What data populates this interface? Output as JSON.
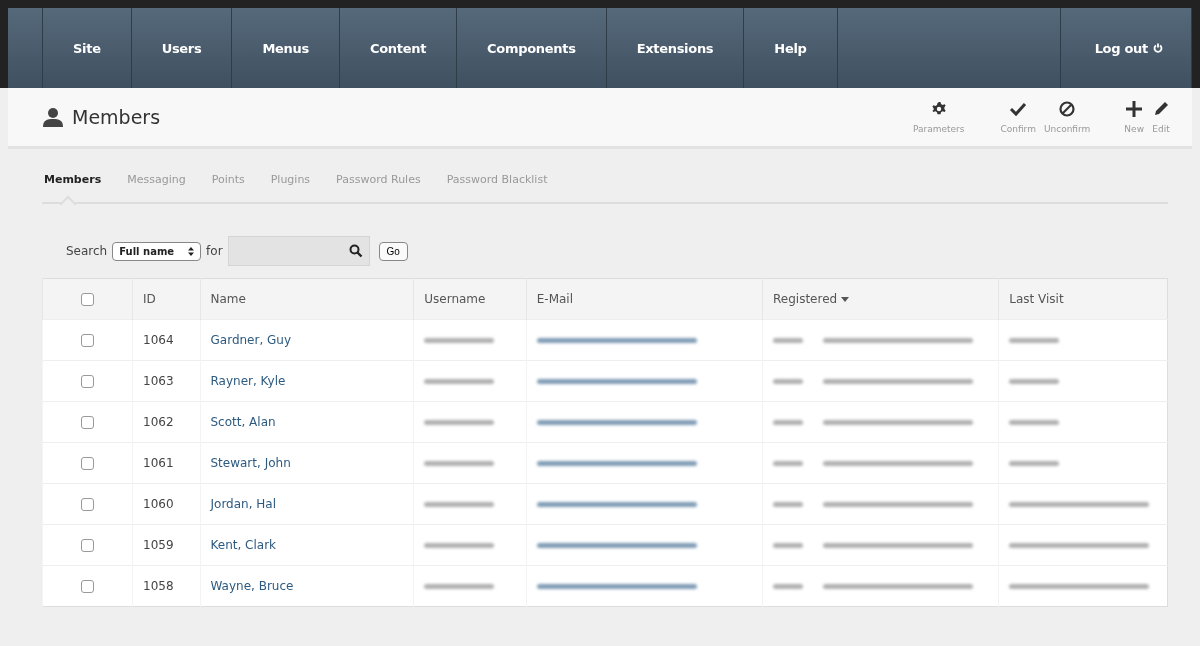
{
  "nav": {
    "items": [
      "Site",
      "Users",
      "Menus",
      "Content",
      "Components",
      "Extensions",
      "Help"
    ],
    "logout": "Log out"
  },
  "page": {
    "title": "Members"
  },
  "toolbar": [
    {
      "kind": "gear",
      "label": "Parameters"
    },
    {
      "kind": "check",
      "label": "Confirm"
    },
    {
      "kind": "ban",
      "label": "Unconfirm"
    },
    {
      "kind": "plus",
      "label": "New"
    },
    {
      "kind": "pencil",
      "label": "Edit"
    }
  ],
  "tabs": [
    {
      "label": "Members",
      "selected": true
    },
    {
      "label": "Messaging",
      "selected": false
    },
    {
      "label": "Points",
      "selected": false
    },
    {
      "label": "Plugins",
      "selected": false
    },
    {
      "label": "Password Rules",
      "selected": false
    },
    {
      "label": "Password Blacklist",
      "selected": false
    }
  ],
  "search": {
    "label": "Search",
    "field_select": "Full name",
    "for_label": "for",
    "go": "Go"
  },
  "table": {
    "select_all_checked": false,
    "columns": [
      {
        "label": "ID",
        "sorted": false
      },
      {
        "label": "Name",
        "sorted": false
      },
      {
        "label": "Username",
        "sorted": false
      },
      {
        "label": "E-Mail",
        "sorted": false
      },
      {
        "label": "Registered",
        "sorted": true
      },
      {
        "label": "Last Visit",
        "sorted": false
      }
    ],
    "rows": [
      {
        "checked": false,
        "id": "1064",
        "name": "Gardner, Guy"
      },
      {
        "checked": false,
        "id": "1063",
        "name": "Rayner, Kyle"
      },
      {
        "checked": false,
        "id": "1062",
        "name": "Scott, Alan"
      },
      {
        "checked": false,
        "id": "1061",
        "name": "Stewart, John"
      },
      {
        "checked": false,
        "id": "1060",
        "name": "Jordan, Hal"
      },
      {
        "checked": false,
        "id": "1059",
        "name": "Kent, Clark"
      },
      {
        "checked": false,
        "id": "1058",
        "name": "Wayne, Bruce"
      }
    ]
  }
}
